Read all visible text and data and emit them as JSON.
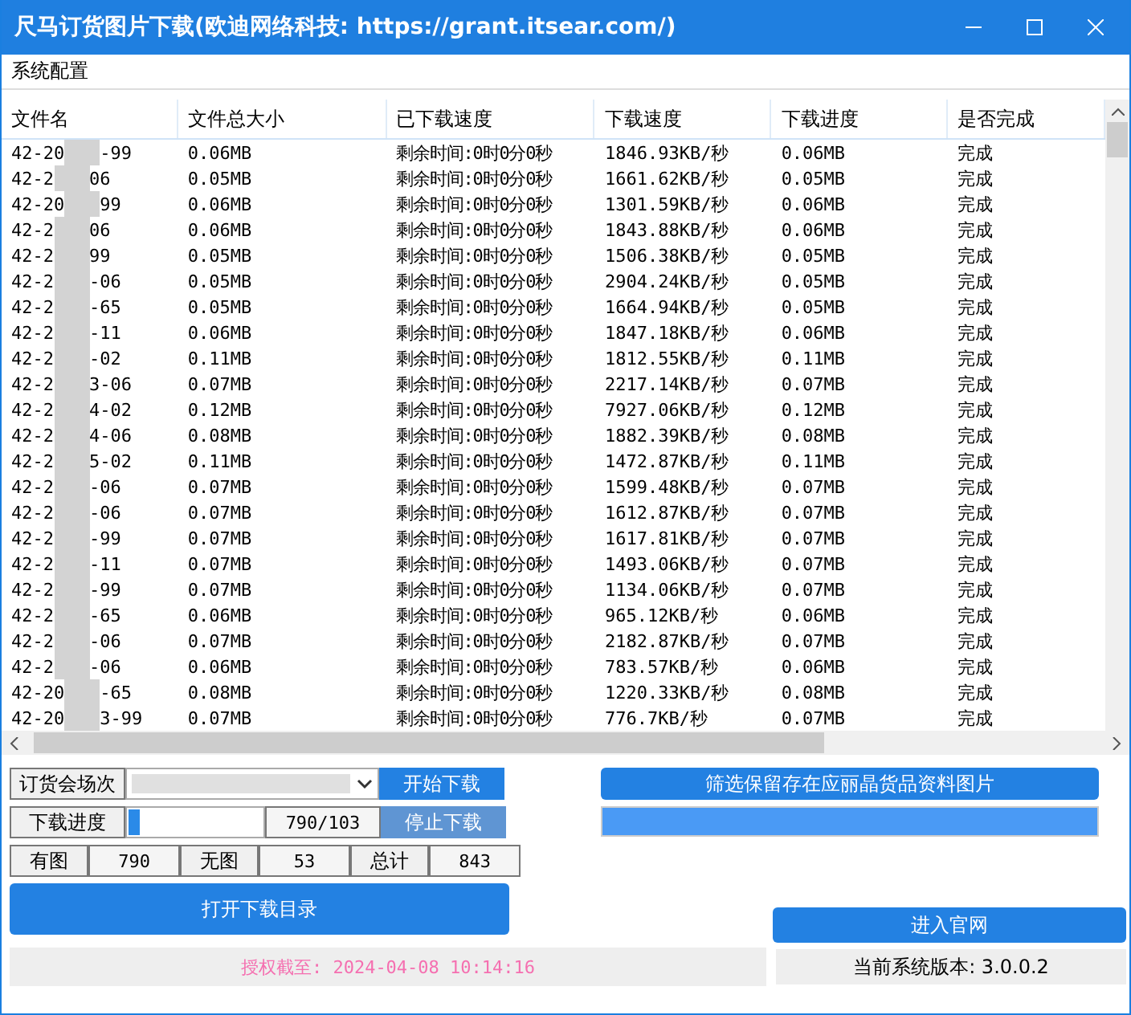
{
  "window": {
    "title": "尺马订货图片下载(欧迪网络科技: https://grant.itsear.com/)"
  },
  "menu": [
    "系统配置"
  ],
  "table": {
    "columns": [
      "文件名",
      "文件总大小",
      "已下载速度",
      "下载速度",
      "下载进度",
      "是否完成"
    ],
    "rows": [
      {
        "name_start": "42-20",
        "name_end": "-99",
        "size": "0.06MB",
        "remaining": "剩余时间:0时0分0秒",
        "speed": "1846.93KB/秒",
        "progress": "0.06MB",
        "done": "完成"
      },
      {
        "name_start": "42-2",
        "name_end": "06",
        "size": "0.05MB",
        "remaining": "剩余时间:0时0分0秒",
        "speed": "1661.62KB/秒",
        "progress": "0.05MB",
        "done": "完成"
      },
      {
        "name_start": "42-20",
        "name_end": "99",
        "size": "0.06MB",
        "remaining": "剩余时间:0时0分0秒",
        "speed": "1301.59KB/秒",
        "progress": "0.06MB",
        "done": "完成"
      },
      {
        "name_start": "42-2",
        "name_end": "06",
        "size": "0.06MB",
        "remaining": "剩余时间:0时0分0秒",
        "speed": "1843.88KB/秒",
        "progress": "0.06MB",
        "done": "完成"
      },
      {
        "name_start": "42-2",
        "name_end": "99",
        "size": "0.05MB",
        "remaining": "剩余时间:0时0分0秒",
        "speed": "1506.38KB/秒",
        "progress": "0.05MB",
        "done": "完成"
      },
      {
        "name_start": "42-2",
        "name_end": "-06",
        "size": "0.05MB",
        "remaining": "剩余时间:0时0分0秒",
        "speed": "2904.24KB/秒",
        "progress": "0.05MB",
        "done": "完成"
      },
      {
        "name_start": "42-2",
        "name_end": "-65",
        "size": "0.05MB",
        "remaining": "剩余时间:0时0分0秒",
        "speed": "1664.94KB/秒",
        "progress": "0.05MB",
        "done": "完成"
      },
      {
        "name_start": "42-2",
        "name_end": "-11",
        "size": "0.06MB",
        "remaining": "剩余时间:0时0分0秒",
        "speed": "1847.18KB/秒",
        "progress": "0.06MB",
        "done": "完成"
      },
      {
        "name_start": "42-2",
        "name_end": "-02",
        "size": "0.11MB",
        "remaining": "剩余时间:0时0分0秒",
        "speed": "1812.55KB/秒",
        "progress": "0.11MB",
        "done": "完成"
      },
      {
        "name_start": "42-2",
        "name_end": "3-06",
        "size": "0.07MB",
        "remaining": "剩余时间:0时0分0秒",
        "speed": "2217.14KB/秒",
        "progress": "0.07MB",
        "done": "完成"
      },
      {
        "name_start": "42-2",
        "name_end": "4-02",
        "size": "0.12MB",
        "remaining": "剩余时间:0时0分0秒",
        "speed": "7927.06KB/秒",
        "progress": "0.12MB",
        "done": "完成"
      },
      {
        "name_start": "42-2",
        "name_end": "4-06",
        "size": "0.08MB",
        "remaining": "剩余时间:0时0分0秒",
        "speed": "1882.39KB/秒",
        "progress": "0.08MB",
        "done": "完成"
      },
      {
        "name_start": "42-2",
        "name_end": "5-02",
        "size": "0.11MB",
        "remaining": "剩余时间:0时0分0秒",
        "speed": "1472.87KB/秒",
        "progress": "0.11MB",
        "done": "完成"
      },
      {
        "name_start": "42-2",
        "name_end": "-06",
        "size": "0.07MB",
        "remaining": "剩余时间:0时0分0秒",
        "speed": "1599.48KB/秒",
        "progress": "0.07MB",
        "done": "完成"
      },
      {
        "name_start": "42-2",
        "name_end": "-06",
        "size": "0.07MB",
        "remaining": "剩余时间:0时0分0秒",
        "speed": "1612.87KB/秒",
        "progress": "0.07MB",
        "done": "完成"
      },
      {
        "name_start": "42-2",
        "name_end": "-99",
        "size": "0.07MB",
        "remaining": "剩余时间:0时0分0秒",
        "speed": "1617.81KB/秒",
        "progress": "0.07MB",
        "done": "完成"
      },
      {
        "name_start": "42-2",
        "name_end": "-11",
        "size": "0.07MB",
        "remaining": "剩余时间:0时0分0秒",
        "speed": "1493.06KB/秒",
        "progress": "0.07MB",
        "done": "完成"
      },
      {
        "name_start": "42-2",
        "name_end": "-99",
        "size": "0.07MB",
        "remaining": "剩余时间:0时0分0秒",
        "speed": "1134.06KB/秒",
        "progress": "0.07MB",
        "done": "完成"
      },
      {
        "name_start": "42-2",
        "name_end": "-65",
        "size": "0.06MB",
        "remaining": "剩余时间:0时0分0秒",
        "speed": "965.12KB/秒",
        "progress": "0.06MB",
        "done": "完成"
      },
      {
        "name_start": "42-2",
        "name_end": "-06",
        "size": "0.07MB",
        "remaining": "剩余时间:0时0分0秒",
        "speed": "2182.87KB/秒",
        "progress": "0.07MB",
        "done": "完成"
      },
      {
        "name_start": "42-2",
        "name_end": "-06",
        "size": "0.06MB",
        "remaining": "剩余时间:0时0分0秒",
        "speed": "783.57KB/秒",
        "progress": "0.06MB",
        "done": "完成"
      },
      {
        "name_start": "42-20",
        "name_end": "-65",
        "size": "0.08MB",
        "remaining": "剩余时间:0时0分0秒",
        "speed": "1220.33KB/秒",
        "progress": "0.08MB",
        "done": "完成"
      },
      {
        "name_start": "42-20",
        "name_end": "3-99",
        "size": "0.07MB",
        "remaining": "剩余时间:0时0分0秒",
        "speed": "776.7KB/秒",
        "progress": "0.07MB",
        "done": "完成"
      }
    ]
  },
  "controls": {
    "session_label": "订货会场次",
    "start_button": "开始下载",
    "progress_label": "下载进度",
    "progress": {
      "level": 0.08,
      "reading": "790/103"
    },
    "stop_button": "停止下载",
    "stop_disabled": true,
    "stats": [
      {
        "label": "有图",
        "value": "790"
      },
      {
        "label": "无图",
        "value": "53"
      },
      {
        "label": "总计",
        "value": "843"
      }
    ],
    "open_button": "打开下载目录",
    "filter_button": "筛选保留存在应丽晶货品资料图片",
    "filter_progress": {
      "level": 1
    },
    "website_button": "进入官网"
  },
  "footer": {
    "license": "授权截至: 2024-04-08 10:14:16",
    "version": "当前系统版本: 3.0.0.2"
  }
}
